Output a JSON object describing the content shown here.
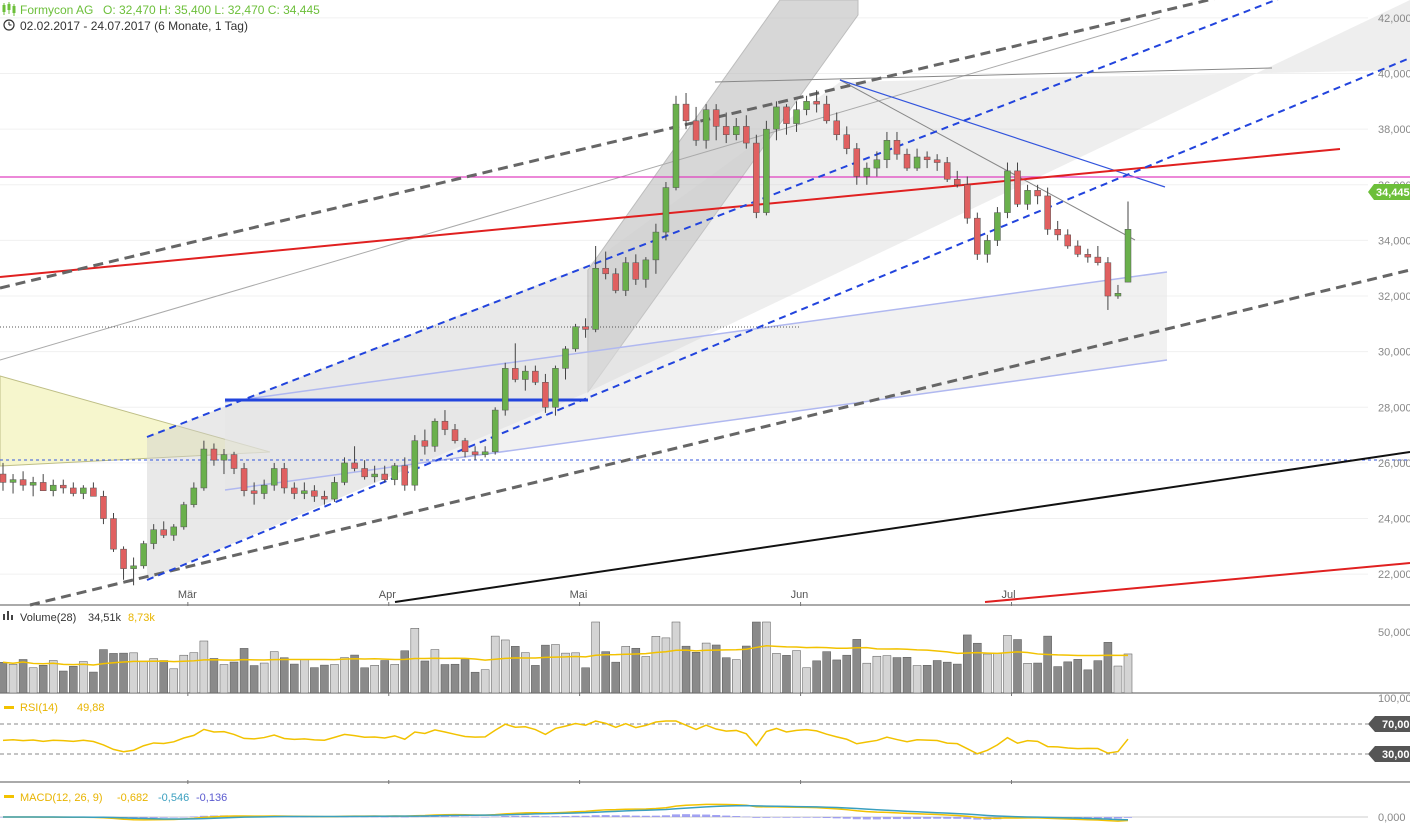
{
  "header": {
    "instrument": "Formycon AG",
    "ohlc_text": "O: 32,470  H: 35,400  L: 32,470  C: 34,445",
    "range_text": "02.02.2017 - 24.07.2017  (6 Monate, 1 Tag)"
  },
  "price_tag": "34,445",
  "panels": {
    "volume": {
      "label": "Volume(28)",
      "v1": "34,51k",
      "v2": "8,73k"
    },
    "rsi": {
      "label": "RSI(14)",
      "v1": "49,88"
    },
    "macd": {
      "label": "MACD(12, 26, 9)",
      "v1": "-0,682",
      "v2": "-0,546",
      "v3": "-0,136"
    }
  },
  "colors": {
    "up": "#6ab04c",
    "down": "#e06060",
    "accent": "#6cbf3a",
    "rsi_line": "#f2c200",
    "macd_line": "#3a9fbf",
    "signal_line": "#f2c200",
    "histogram": "#8c8cf0"
  },
  "chart_data": {
    "type": "candlestick",
    "x_ticks": [
      "Mär",
      "Apr",
      "Mai",
      "Jun",
      "Jul"
    ],
    "y_ticks": [
      "22,000",
      "24,000",
      "26,000",
      "28,000",
      "30,000",
      "32,000",
      "34,000",
      "36,000",
      "38,000",
      "40,000",
      "42,000"
    ],
    "ylim": [
      21,
      42.5
    ],
    "volume_ticks": [
      "50,000",
      "100,000"
    ],
    "rsi_ticks": [
      "70,000",
      "30,000"
    ],
    "macd_ticks": [
      "0,000"
    ],
    "series": [
      {
        "name": "Formycon AG",
        "candles": [
          [
            25.6,
            26.0,
            25.0,
            25.3
          ],
          [
            25.3,
            25.6,
            24.9,
            25.4
          ],
          [
            25.4,
            25.7,
            25.0,
            25.2
          ],
          [
            25.2,
            25.5,
            24.8,
            25.3
          ],
          [
            25.3,
            25.6,
            25.0,
            25.0
          ],
          [
            25.0,
            25.4,
            24.8,
            25.2
          ],
          [
            25.2,
            25.4,
            24.9,
            25.1
          ],
          [
            25.1,
            25.3,
            24.8,
            24.9
          ],
          [
            24.9,
            25.2,
            24.7,
            25.1
          ],
          [
            25.1,
            25.3,
            24.9,
            24.8
          ],
          [
            24.8,
            25.0,
            23.8,
            24.0
          ],
          [
            24.0,
            24.2,
            22.8,
            22.9
          ],
          [
            22.9,
            23.0,
            21.8,
            22.2
          ],
          [
            22.2,
            22.6,
            21.6,
            22.3
          ],
          [
            22.3,
            23.2,
            22.2,
            23.1
          ],
          [
            23.1,
            23.8,
            22.9,
            23.6
          ],
          [
            23.6,
            23.9,
            23.3,
            23.4
          ],
          [
            23.4,
            23.8,
            23.2,
            23.7
          ],
          [
            23.7,
            24.6,
            23.6,
            24.5
          ],
          [
            24.5,
            25.3,
            24.4,
            25.1
          ],
          [
            25.1,
            26.8,
            25.0,
            26.5
          ],
          [
            26.5,
            26.7,
            25.9,
            26.1
          ],
          [
            26.1,
            26.5,
            25.6,
            26.3
          ],
          [
            26.3,
            26.4,
            25.6,
            25.8
          ],
          [
            25.8,
            26.0,
            24.8,
            25.0
          ],
          [
            25.0,
            25.3,
            24.5,
            24.9
          ],
          [
            24.9,
            25.4,
            24.7,
            25.2
          ],
          [
            25.2,
            26.0,
            25.0,
            25.8
          ],
          [
            25.8,
            26.0,
            24.9,
            25.1
          ],
          [
            25.1,
            25.3,
            24.7,
            24.9
          ],
          [
            24.9,
            25.3,
            24.7,
            25.0
          ],
          [
            25.0,
            25.2,
            24.6,
            24.8
          ],
          [
            24.8,
            25.0,
            24.5,
            24.7
          ],
          [
            24.7,
            25.5,
            24.6,
            25.3
          ],
          [
            25.3,
            26.2,
            25.2,
            26.0
          ],
          [
            26.0,
            26.6,
            25.7,
            25.8
          ],
          [
            25.8,
            26.1,
            25.4,
            25.5
          ],
          [
            25.5,
            25.9,
            25.3,
            25.6
          ],
          [
            25.6,
            25.9,
            25.3,
            25.4
          ],
          [
            25.4,
            26.0,
            25.2,
            25.9
          ],
          [
            25.9,
            26.2,
            25.0,
            25.2
          ],
          [
            25.2,
            27.0,
            25.0,
            26.8
          ],
          [
            26.8,
            27.2,
            26.3,
            26.6
          ],
          [
            26.6,
            27.6,
            26.4,
            27.5
          ],
          [
            27.5,
            27.9,
            27.0,
            27.2
          ],
          [
            27.2,
            27.4,
            26.7,
            26.8
          ],
          [
            26.8,
            26.9,
            26.2,
            26.4
          ],
          [
            26.4,
            26.6,
            26.1,
            26.3
          ],
          [
            26.3,
            26.6,
            26.2,
            26.4
          ],
          [
            26.4,
            28.0,
            26.3,
            27.9
          ],
          [
            27.9,
            29.6,
            27.7,
            29.4
          ],
          [
            29.4,
            30.3,
            28.9,
            29.0
          ],
          [
            29.0,
            29.5,
            28.6,
            29.3
          ],
          [
            29.3,
            29.5,
            28.8,
            28.9
          ],
          [
            28.9,
            29.2,
            27.8,
            28.0
          ],
          [
            28.0,
            29.5,
            27.7,
            29.4
          ],
          [
            29.4,
            30.2,
            29.0,
            30.1
          ],
          [
            30.1,
            31.0,
            30.0,
            30.9
          ],
          [
            30.9,
            31.2,
            30.5,
            30.8
          ],
          [
            30.8,
            33.8,
            30.7,
            33.0
          ],
          [
            33.0,
            33.6,
            32.6,
            32.8
          ],
          [
            32.8,
            33.0,
            32.1,
            32.2
          ],
          [
            32.2,
            33.4,
            32.0,
            33.2
          ],
          [
            33.2,
            33.5,
            32.4,
            32.6
          ],
          [
            32.6,
            33.4,
            32.3,
            33.3
          ],
          [
            33.3,
            34.6,
            32.8,
            34.3
          ],
          [
            34.3,
            36.1,
            34.0,
            35.9
          ],
          [
            35.9,
            39.2,
            35.8,
            38.9
          ],
          [
            38.9,
            39.3,
            38.0,
            38.3
          ],
          [
            38.3,
            38.8,
            37.4,
            37.6
          ],
          [
            37.6,
            38.9,
            37.3,
            38.7
          ],
          [
            38.7,
            38.9,
            37.6,
            38.1
          ],
          [
            38.1,
            38.6,
            37.5,
            37.8
          ],
          [
            37.8,
            38.4,
            37.6,
            38.1
          ],
          [
            38.1,
            38.5,
            37.3,
            37.5
          ],
          [
            37.5,
            37.8,
            34.8,
            35.0
          ],
          [
            35.0,
            38.3,
            34.9,
            38.0
          ],
          [
            38.0,
            39.0,
            37.6,
            38.8
          ],
          [
            38.8,
            38.9,
            37.8,
            38.2
          ],
          [
            38.2,
            39.0,
            37.9,
            38.7
          ],
          [
            38.7,
            39.2,
            38.5,
            39.0
          ],
          [
            39.0,
            39.4,
            38.6,
            38.9
          ],
          [
            38.9,
            39.2,
            38.2,
            38.3
          ],
          [
            38.3,
            38.6,
            37.6,
            37.8
          ],
          [
            37.8,
            38.1,
            37.1,
            37.3
          ],
          [
            37.3,
            37.5,
            36.0,
            36.3
          ],
          [
            36.3,
            36.8,
            36.0,
            36.6
          ],
          [
            36.6,
            37.2,
            36.3,
            36.9
          ],
          [
            36.9,
            37.9,
            36.6,
            37.6
          ],
          [
            37.6,
            37.9,
            36.9,
            37.1
          ],
          [
            37.1,
            37.3,
            36.5,
            36.6
          ],
          [
            36.6,
            37.3,
            36.5,
            37.0
          ],
          [
            37.0,
            37.2,
            36.6,
            36.9
          ],
          [
            36.9,
            37.1,
            36.5,
            36.8
          ],
          [
            36.8,
            37.0,
            36.1,
            36.2
          ],
          [
            36.2,
            36.5,
            35.9,
            36.0
          ],
          [
            36.0,
            36.3,
            34.6,
            34.8
          ],
          [
            34.8,
            35.0,
            33.3,
            33.5
          ],
          [
            33.5,
            34.2,
            33.2,
            34.0
          ],
          [
            34.0,
            35.2,
            33.8,
            35.0
          ],
          [
            35.0,
            36.8,
            34.8,
            36.5
          ],
          [
            36.5,
            36.8,
            35.2,
            35.3
          ],
          [
            35.3,
            36.0,
            35.1,
            35.8
          ],
          [
            35.8,
            36.0,
            35.3,
            35.6
          ],
          [
            35.6,
            35.9,
            34.2,
            34.4
          ],
          [
            34.4,
            34.7,
            34.0,
            34.2
          ],
          [
            34.2,
            34.4,
            33.7,
            33.8
          ],
          [
            33.8,
            34.0,
            33.4,
            33.5
          ],
          [
            33.5,
            33.7,
            33.2,
            33.4
          ],
          [
            33.4,
            33.8,
            33.1,
            33.2
          ],
          [
            33.2,
            33.4,
            31.5,
            32.0
          ],
          [
            32.0,
            32.4,
            31.9,
            32.1
          ],
          [
            32.5,
            35.4,
            32.5,
            34.4
          ]
        ]
      }
    ]
  }
}
